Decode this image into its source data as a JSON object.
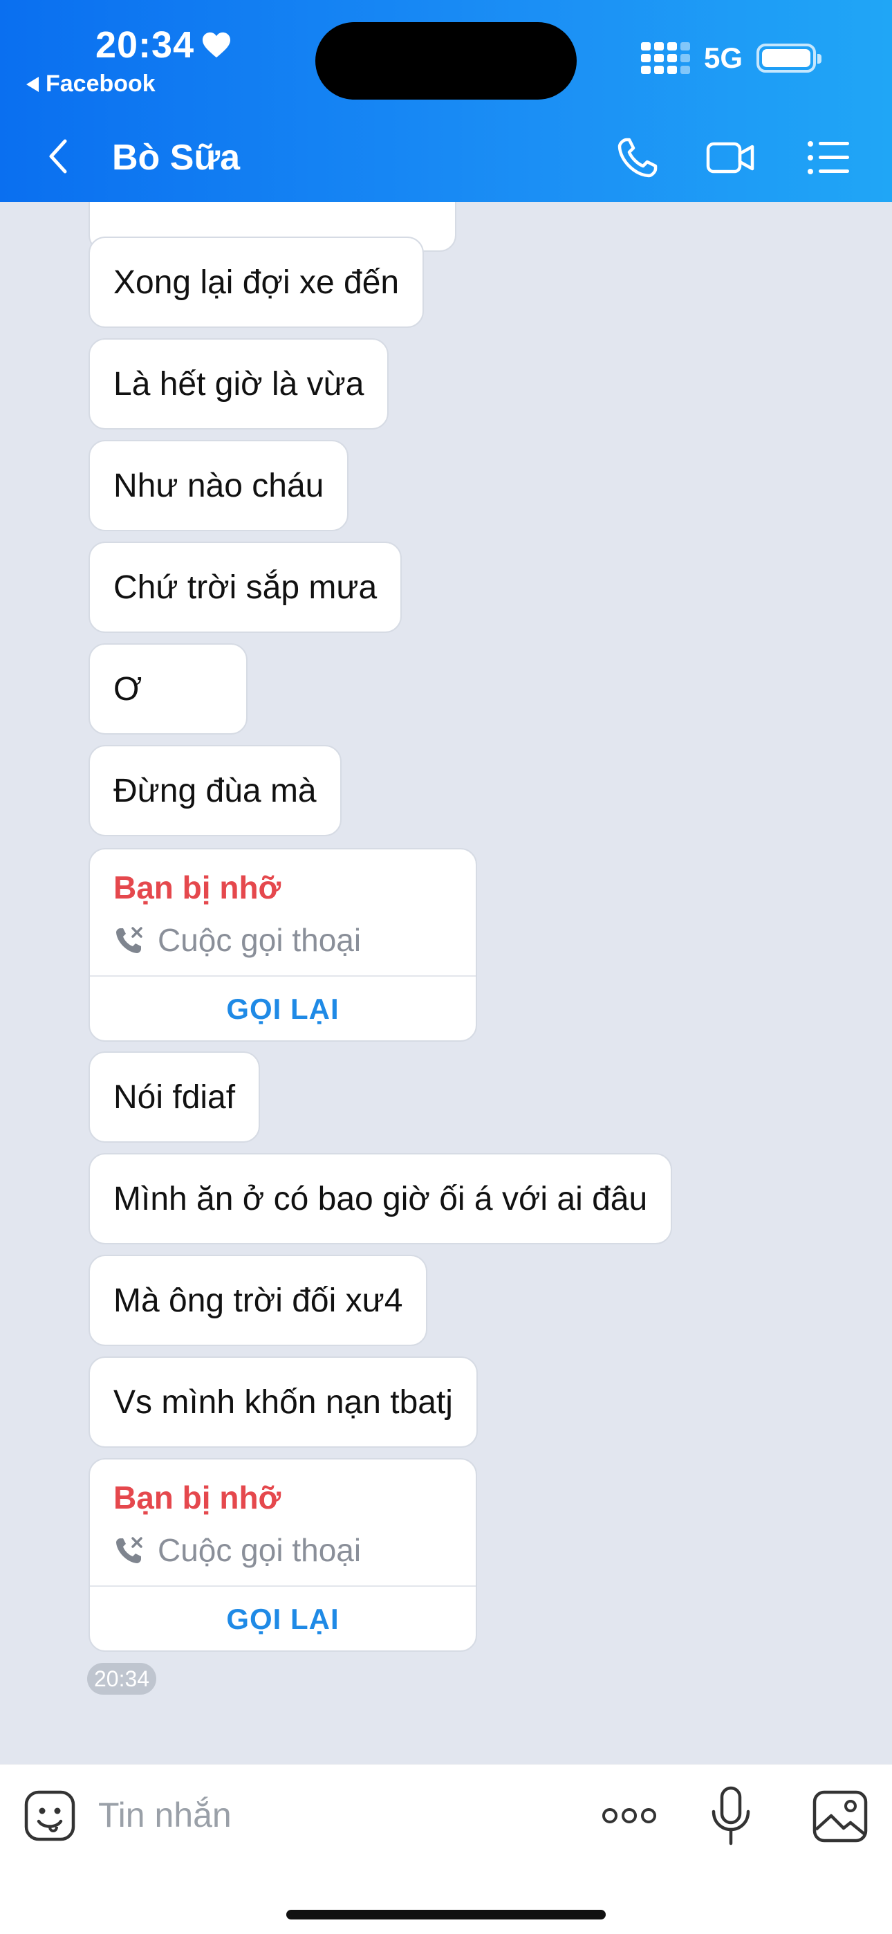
{
  "status_bar": {
    "time": "20:34",
    "back_app": "Facebook",
    "network": "5G"
  },
  "header": {
    "title": "Bò Sữa"
  },
  "messages": [
    "Xong lại đợi xe đến",
    "Là hết giờ là vừa",
    "Như nào cháu",
    "Chứ trời sắp mưa",
    "Ơ",
    "Đừng đùa mà",
    "Nói fdiaf",
    "Mình ăn ở có bao giờ ối á với ai đâu",
    "Mà ông trời đối xư4",
    "Vs mình khốn nạn tbatj"
  ],
  "missed_calls": [
    {
      "title": "Bạn bị nhỡ",
      "subtitle": "Cuộc gọi thoại",
      "action": "GỌI LẠI"
    },
    {
      "title": "Bạn bị nhỡ",
      "subtitle": "Cuộc gọi thoại",
      "action": "GỌI LẠI"
    }
  ],
  "last_time": "20:34",
  "composer": {
    "placeholder": "Tin nhắn"
  },
  "colors": {
    "header_start": "#0a6ff0",
    "header_end": "#20a6f6",
    "missed_red": "#e5484d",
    "callback_blue": "#1f8ae6",
    "chat_bg": "#e2e6ef"
  }
}
